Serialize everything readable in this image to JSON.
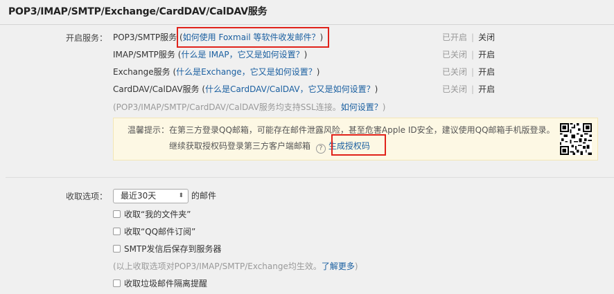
{
  "header": {
    "title": "POP3/IMAP/SMTP/Exchange/CardDAV/CalDAV服务"
  },
  "services_label": "开启服务：",
  "services": [
    {
      "name": "POP3/SMTP服务",
      "help_prefix": "(",
      "help_link": "如何使用 Foxmail 等软件收发邮件？",
      "help_suffix": ")",
      "status": "已开启",
      "separator": "|",
      "toggle": "关闭"
    },
    {
      "name": "IMAP/SMTP服务",
      "help_prefix": "(",
      "help_link": "什么是 IMAP，它又是如何设置？",
      "help_suffix": ")",
      "status": "已关闭",
      "separator": "|",
      "toggle": "开启"
    },
    {
      "name": "Exchange服务",
      "help_prefix": "(",
      "help_link": "什么是Exchange，它又是如何设置？",
      "help_suffix": ")",
      "status": "已关闭",
      "separator": "|",
      "toggle": "开启"
    },
    {
      "name": "CardDAV/CalDAV服务",
      "help_prefix": "(",
      "help_link": "什么是CardDAV/CalDAV，它又是如何设置？",
      "help_suffix": ")",
      "status": "已关闭",
      "separator": "|",
      "toggle": "开启"
    }
  ],
  "ssl_note": {
    "text": "(POP3/IMAP/SMTP/CardDAV/CalDAV服务均支持SSL连接。",
    "link": "如何设置？",
    "suffix": ")"
  },
  "tip": {
    "line1": "温馨提示：在第三方登录QQ邮箱，可能存在邮件泄露风险，甚至危害Apple ID安全，建议使用QQ邮箱手机版登录。",
    "line2": "继续获取授权码登录第三方客户端邮箱",
    "help_glyph": "?",
    "action": "生成授权码",
    "qr_icon": "qr-code-icon"
  },
  "receive": {
    "label": "收取选项：",
    "select_value": "最近30天",
    "select_arrow": "⬍",
    "select_suffix": "的邮件",
    "options": [
      "收取“我的文件夹”",
      "收取“QQ邮件订阅”",
      "SMTP发信后保存到服务器"
    ],
    "note": "(以上收取选项对POP3/IMAP/SMTP/Exchange均生效。",
    "note_link": "了解更多",
    "note_suffix": ")",
    "spam_option": "收取垃圾邮件隔离提醒"
  },
  "colors": {
    "accent_red": "#e0221a",
    "link_blue": "#1a5fa0",
    "tip_bg": "#fdf8e4"
  }
}
